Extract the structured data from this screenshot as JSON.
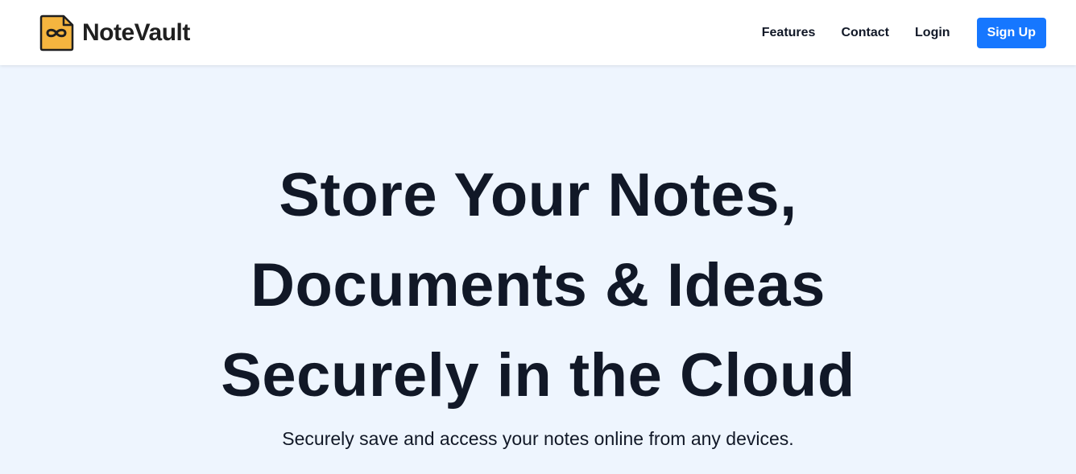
{
  "brand": {
    "name": "NoteVault",
    "icon": "infinity-note-icon",
    "icon_color": "#f5b53f"
  },
  "nav": {
    "features": "Features",
    "contact": "Contact",
    "login": "Login",
    "signup": "Sign Up"
  },
  "hero": {
    "title": "Store Your Notes, Documents & Ideas Securely in the Cloud",
    "subtitle": "Securely save and access your notes online from any devices."
  },
  "colors": {
    "accent": "#1677ff",
    "hero_bg": "#eef5fe",
    "text": "#111827"
  }
}
